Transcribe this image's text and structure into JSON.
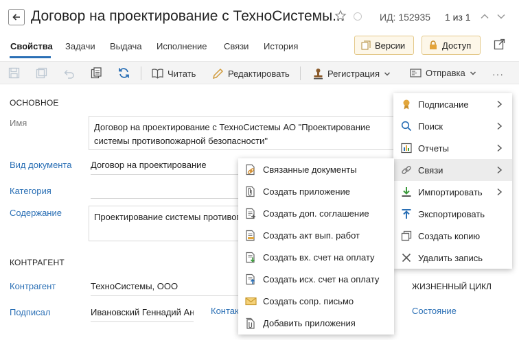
{
  "header": {
    "title": "Договор на проектирование с ТехноСистемы...",
    "id_label": "ИД: 152935",
    "pager": "1 из 1"
  },
  "tabs": [
    {
      "label": "Свойства",
      "active": true
    },
    {
      "label": "Задачи"
    },
    {
      "label": "Выдача"
    },
    {
      "label": "Исполнение"
    },
    {
      "label": "Связи"
    },
    {
      "label": "История"
    }
  ],
  "header_buttons": {
    "versions": "Версии",
    "access": "Доступ"
  },
  "toolbar": {
    "read": "Читать",
    "edit": "Редактировать",
    "registration": "Регистрация",
    "send": "Отправка",
    "more": "···"
  },
  "form": {
    "section_main": "ОСНОВНОЕ",
    "name_label": "Имя",
    "name_value": "Договор на проектирование с ТехноСистемы АО \"Проектирование системы противопожарной безопасности\"",
    "doc_type_label": "Вид документа",
    "doc_type_value": "Договор на проектирование",
    "category_label": "Категория",
    "content_label": "Содержание",
    "content_value": "Проектирование системы противопожарной безопасности",
    "section_counterparty": "КОНТРАГЕНТ",
    "counterparty_label": "Контрагент",
    "counterparty_value": "ТехноСистемы, ООО",
    "signed_label": "Подписал",
    "signed_value": "Ивановский Геннадий Андреевич",
    "contact_label": "Контакт",
    "lifecycle_section": "ЖИЗНЕННЫЙ ЦИКЛ",
    "state_label": "Состояние"
  },
  "main_menu": [
    {
      "label": "Подписание",
      "icon": "seal-icon",
      "submenu": true
    },
    {
      "label": "Поиск",
      "icon": "search-icon",
      "submenu": true
    },
    {
      "label": "Отчеты",
      "icon": "report-icon",
      "submenu": true
    },
    {
      "label": "Связи",
      "icon": "link-icon",
      "submenu": true,
      "highlighted": true
    },
    {
      "label": "Импортировать",
      "icon": "import-icon",
      "submenu": true
    },
    {
      "label": "Экспортировать",
      "icon": "export-icon",
      "submenu": false
    },
    {
      "label": "Создать копию",
      "icon": "copy-icon",
      "submenu": false
    },
    {
      "label": "Удалить запись",
      "icon": "delete-icon",
      "submenu": false
    }
  ],
  "sub_menu": [
    {
      "label": "Связанные документы",
      "icon": "related-docs-icon"
    },
    {
      "label": "Создать приложение",
      "icon": "attachment-icon"
    },
    {
      "label": "Создать доп. соглашение",
      "icon": "add-agreement-icon"
    },
    {
      "label": "Создать акт вып. работ",
      "icon": "act-icon"
    },
    {
      "label": "Создать вх. счет на оплату",
      "icon": "incoming-invoice-icon"
    },
    {
      "label": "Создать исх. счет на оплату",
      "icon": "outgoing-invoice-icon"
    },
    {
      "label": "Создать сопр. письмо",
      "icon": "letter-icon"
    },
    {
      "label": "Добавить приложения",
      "icon": "add-attachments-icon"
    }
  ],
  "colors": {
    "accent": "#2a6fb5",
    "highlight": "#ececec",
    "button_bg": "#fdf7e9"
  }
}
